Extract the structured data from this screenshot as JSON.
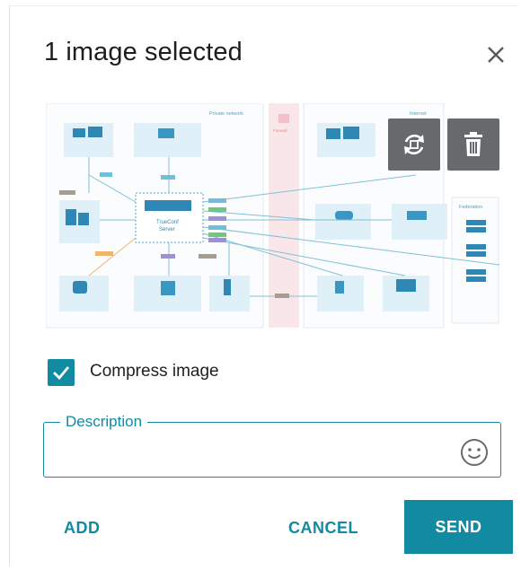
{
  "dialog": {
    "title": "1 image selected",
    "close_icon": "close-icon"
  },
  "preview": {
    "diagram": {
      "private_network_label": "Private network",
      "firewall_label": "Firewall",
      "internet_label": "Internet",
      "federation_label": "Federation",
      "server_label_1": "TrueConf",
      "server_label_2": "Server"
    },
    "tools": [
      {
        "icon": "rotate-icon"
      },
      {
        "icon": "trash-icon"
      }
    ]
  },
  "compress": {
    "label": "Compress image",
    "checked": true
  },
  "description": {
    "label": "Description",
    "value": "",
    "emoji_icon": "emoji-icon"
  },
  "actions": {
    "add": "ADD",
    "cancel": "CANCEL",
    "send": "SEND"
  },
  "colors": {
    "accent": "#118aa2",
    "tool_bg": "#666a6c"
  }
}
